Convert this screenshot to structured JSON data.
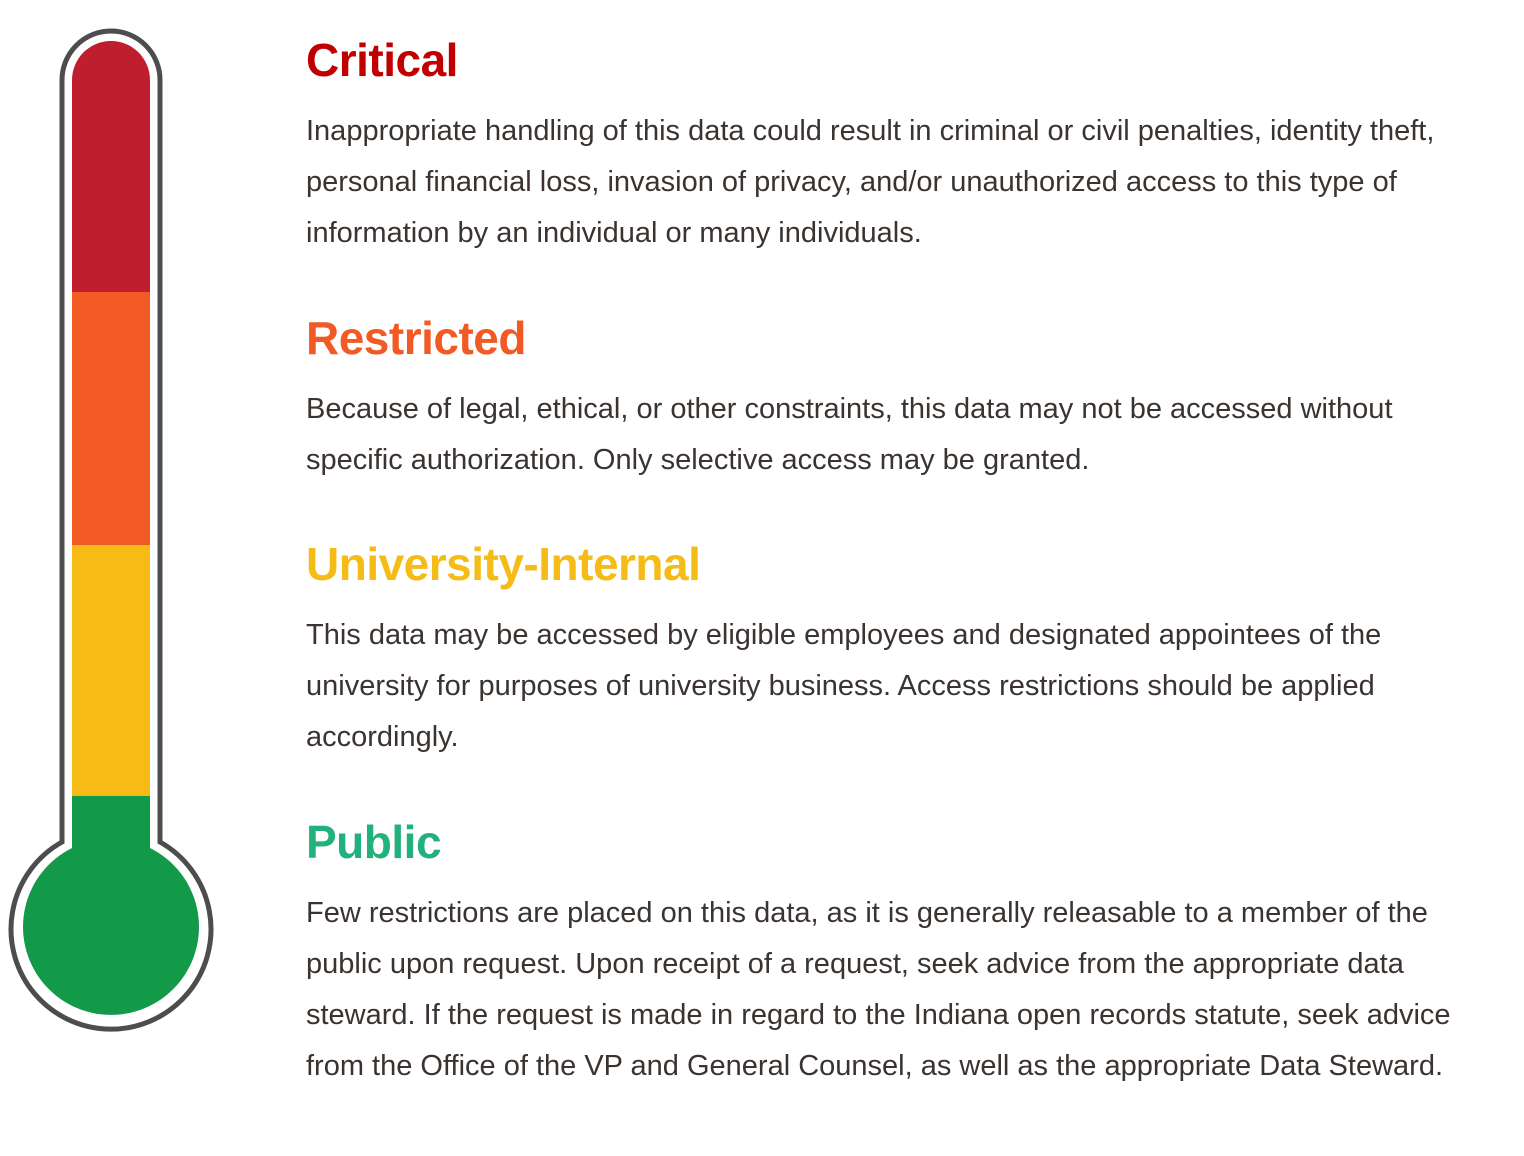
{
  "thermometer": {
    "segment_colors": [
      "#be1e2d",
      "#f15a24",
      "#f7bb16",
      "#129a48"
    ],
    "outline_color": "#4d4d4d"
  },
  "levels": [
    {
      "title": "Critical",
      "color": "#c00000",
      "description": "Inappropriate handling of this data could result in criminal or civil penalties, identity theft, personal financial loss, invasion of privacy, and/or unauthorized access to this type of information by an individual or many individuals."
    },
    {
      "title": "Restricted",
      "color": "#f15a24",
      "description": "Because of legal, ethical, or other constraints, this data may not be accessed without specific authorization. Only selective access may be granted."
    },
    {
      "title": "University-Internal",
      "color": "#f5bc17",
      "description": "This data may be accessed by eligible employees and designated appointees of the university for purposes of university business. Access restrictions should be applied accordingly."
    },
    {
      "title": "Public",
      "color": "#22b17c",
      "description": "Few restrictions are placed on this data, as it is generally releasable to a member of the public upon request. Upon receipt of a request, seek advice from the appropriate data steward. If the request is made in regard to the Indiana open records statute, seek advice from the Office of the VP and General Counsel, as well as the appropriate Data Steward."
    }
  ]
}
